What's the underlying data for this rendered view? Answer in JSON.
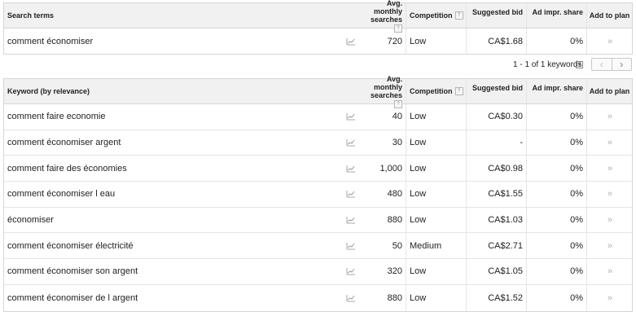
{
  "headers": {
    "search_terms": "Search terms",
    "keyword": "Keyword (by relevance)",
    "avg_line1": "Avg. monthly",
    "avg_line2": "searches",
    "competition": "Competition",
    "suggested_bid": "Suggested bid",
    "ad_impr": "Ad impr. share",
    "add_to_plan": "Add to plan",
    "help": "?"
  },
  "search_terms": [
    {
      "keyword": "comment économiser",
      "avg": "720",
      "competition": "Low",
      "bid": "CA$1.68",
      "impr": "0%"
    }
  ],
  "pagination": {
    "text": "1 - 1 of 1 keywords",
    "prev": "‹",
    "next": "›"
  },
  "keywords": [
    {
      "keyword": "comment faire economie",
      "avg": "40",
      "competition": "Low",
      "bid": "CA$0.30",
      "impr": "0%"
    },
    {
      "keyword": "comment économiser argent",
      "avg": "30",
      "competition": "Low",
      "bid": "-",
      "impr": "0%"
    },
    {
      "keyword": "comment faire des économies",
      "avg": "1,000",
      "competition": "Low",
      "bid": "CA$0.98",
      "impr": "0%"
    },
    {
      "keyword": "comment économiser l eau",
      "avg": "480",
      "competition": "Low",
      "bid": "CA$1.55",
      "impr": "0%"
    },
    {
      "keyword": "économiser",
      "avg": "880",
      "competition": "Low",
      "bid": "CA$1.03",
      "impr": "0%"
    },
    {
      "keyword": "comment économiser électricité",
      "avg": "50",
      "competition": "Medium",
      "bid": "CA$2.71",
      "impr": "0%"
    },
    {
      "keyword": "comment économiser son argent",
      "avg": "320",
      "competition": "Low",
      "bid": "CA$1.05",
      "impr": "0%"
    },
    {
      "keyword": "comment économiser de l argent",
      "avg": "880",
      "competition": "Low",
      "bid": "CA$1.52",
      "impr": "0%"
    }
  ],
  "icons": {
    "trend": "trend-chart-icon",
    "add": "double-chevron-icon",
    "dropdown": "dropdown-icon"
  }
}
